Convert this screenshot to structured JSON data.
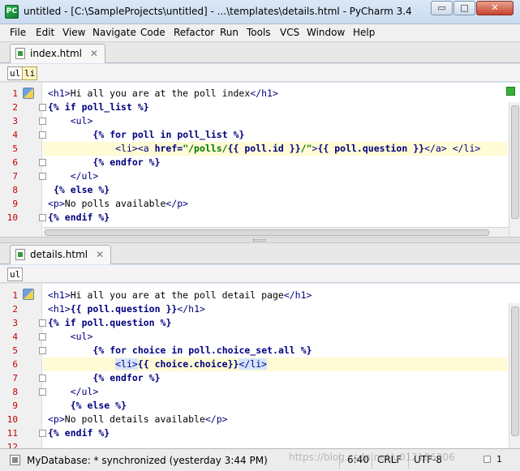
{
  "window": {
    "title": "untitled - [C:\\SampleProjects\\untitled] - ...\\templates\\details.html - PyCharm 3.4",
    "controls": {
      "minimize": "▭",
      "maximize": "□",
      "close": "✕"
    }
  },
  "menu": [
    "File",
    "Edit",
    "View",
    "Navigate",
    "Code",
    "Refactor",
    "Run",
    "Tools",
    "VCS",
    "Window",
    "Help"
  ],
  "top_editor": {
    "tab": "index.html",
    "breadcrumbs": [
      "ul",
      "li"
    ],
    "line_numbers": [
      "1",
      "2",
      "3",
      "4",
      "5",
      "6",
      "7",
      "8",
      "9",
      "10"
    ],
    "current_line": 5
  },
  "bottom_editor": {
    "tab": "details.html",
    "breadcrumbs": [
      "ul"
    ],
    "line_numbers": [
      "1",
      "2",
      "3",
      "4",
      "5",
      "6",
      "7",
      "8",
      "9",
      "10",
      "11",
      "12"
    ],
    "current_line": 6
  },
  "status": {
    "message": "MyDatabase: * synchronized (yesterday 3:44 PM)",
    "position": "6:40",
    "line_separator": "CRLF",
    "encoding": "UTF-8",
    "watermark": "https://blog.csdn.net/u012106306",
    "extra": "1"
  },
  "colors": {
    "line_number": "#c40000",
    "tag": "#000080",
    "string": "#007a00",
    "current_line": "#fffbd4"
  }
}
